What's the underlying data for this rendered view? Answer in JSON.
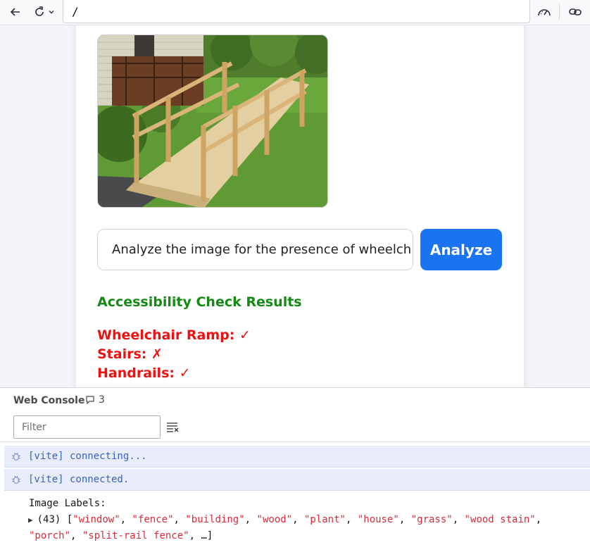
{
  "toolbar": {
    "url": "/"
  },
  "page": {
    "image_alt": "Wooden wheelchair ramp with handrails beside a house",
    "prompt_value": "Analyze the image for the presence of wheelch",
    "analyze_label": "Analyze",
    "results_title": "Accessibility Check Results",
    "results": [
      {
        "label": "Wheelchair Ramp:",
        "mark": "✓"
      },
      {
        "label": "Stairs:",
        "mark": "✗"
      },
      {
        "label": "Handrails:",
        "mark": "✓"
      }
    ]
  },
  "console": {
    "title": "Web Console",
    "message_count": "3",
    "filter_placeholder": "Filter",
    "logs": [
      "[vite] connecting...",
      "[vite] connected."
    ],
    "labels_heading": "Image Labels:",
    "labels_count": "(43) [",
    "labels_line1": [
      "window",
      "fence",
      "building",
      "wood",
      "plant",
      "house",
      "grass",
      "wood stain"
    ],
    "labels_line2": [
      "porch",
      "split-rail fence"
    ],
    "labels_tail": "…]"
  },
  "colors": {
    "analyze_button": "#1a73f0",
    "results_title": "#148a14",
    "results_text": "#ee1111",
    "log_background": "#e8ecfb"
  }
}
